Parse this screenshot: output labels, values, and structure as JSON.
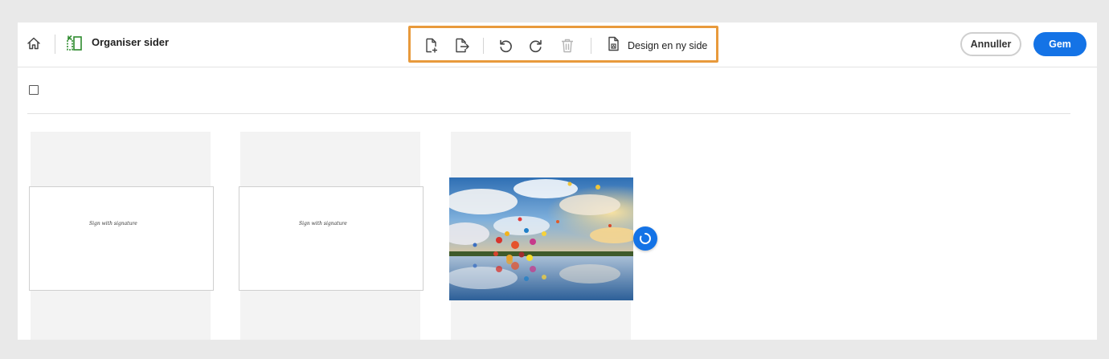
{
  "header": {
    "tool_title": "Organiser sider",
    "toolbar": {
      "insert_icon": "page-add-icon",
      "extract_icon": "page-export-icon",
      "rotate_ccw_icon": "rotate-counterclockwise-icon",
      "rotate_cw_icon": "rotate-clockwise-icon",
      "delete_icon": "trash-icon",
      "design_icon": "page-design-icon",
      "design_label": "Design en ny side"
    },
    "cancel_label": "Annuller",
    "save_label": "Gem"
  },
  "pages": [
    {
      "kind": "document",
      "signature_text": "Sign with signature"
    },
    {
      "kind": "document",
      "signature_text": "Sign with signature"
    },
    {
      "kind": "image",
      "description_icon": "hot-air-balloons-photo"
    }
  ],
  "colors": {
    "accent": "#1473e6",
    "toolbar_highlight": "#e89a3c",
    "page_background": "#e9e9e9",
    "slot_background": "#f3f3f3"
  },
  "select_all_checked": false
}
